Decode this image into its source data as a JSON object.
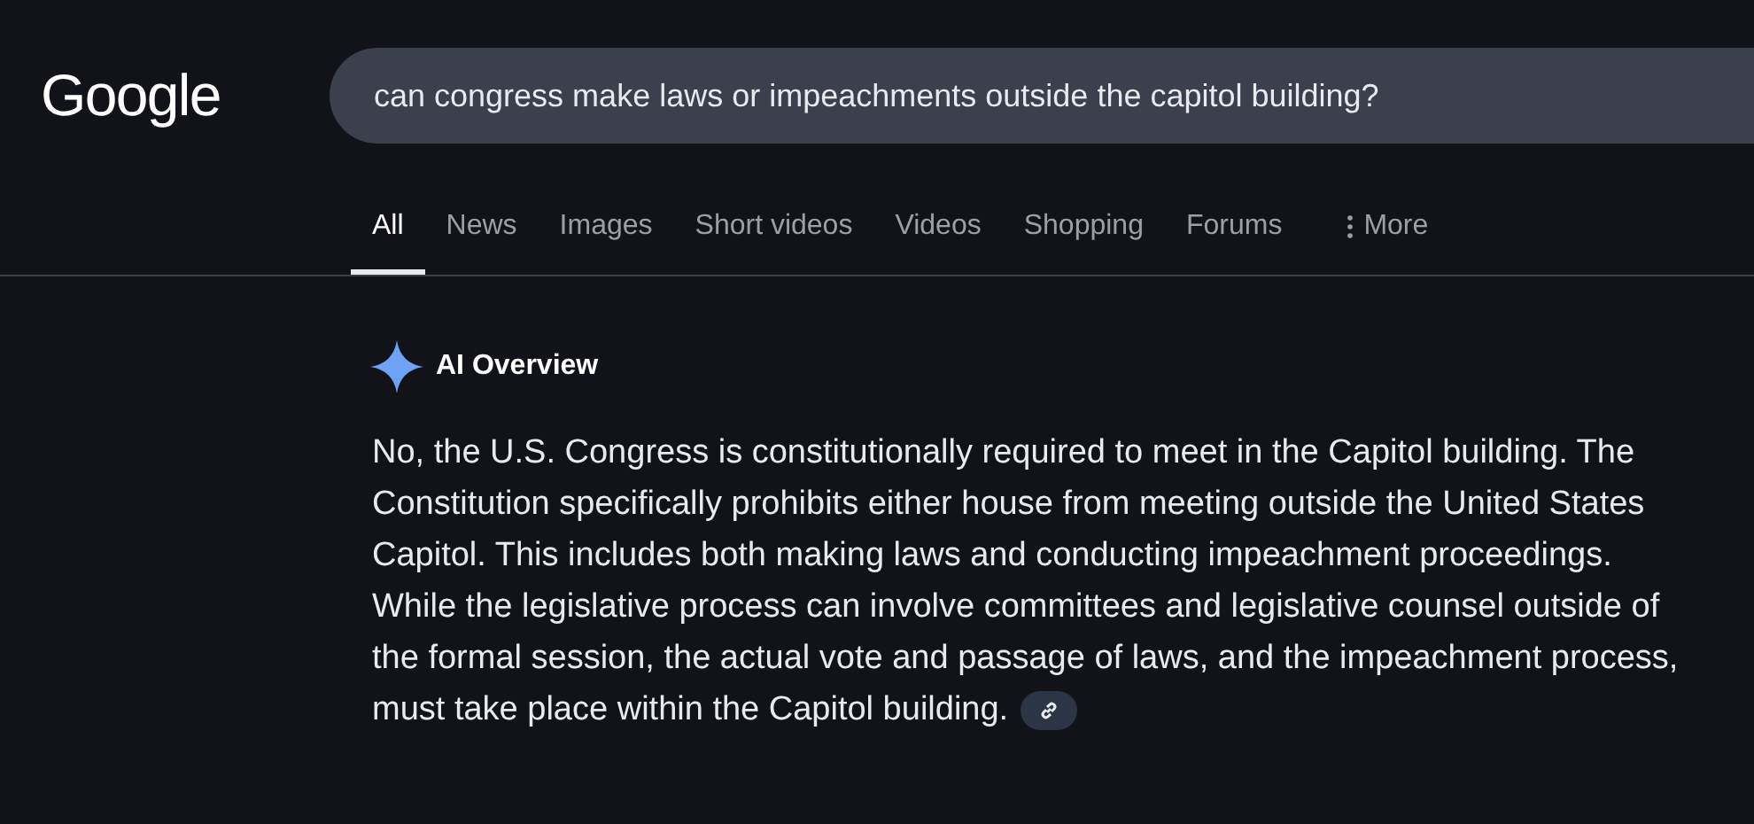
{
  "logo": "Google",
  "search": {
    "value": "can congress make laws or impeachments outside the capitol building?"
  },
  "tabs": [
    {
      "label": "All",
      "selected": true,
      "kind": "plain"
    },
    {
      "label": "News",
      "selected": false,
      "kind": "plain"
    },
    {
      "label": "Images",
      "selected": false,
      "kind": "plain"
    },
    {
      "label": "Short videos",
      "selected": false,
      "kind": "plain"
    },
    {
      "label": "Videos",
      "selected": false,
      "kind": "plain"
    },
    {
      "label": "Shopping",
      "selected": false,
      "kind": "plain"
    },
    {
      "label": "Forums",
      "selected": false,
      "kind": "plain"
    },
    {
      "label": "More",
      "selected": false,
      "kind": "more"
    }
  ],
  "ai_overview": {
    "title": "AI Overview",
    "text": "No, the U.S. Congress is constitutionally required to meet in the Capitol building. The Constitution specifically prohibits either house from meeting outside the United States Capitol. This includes both making laws and conducting impeachment proceedings. While the legislative process can involve committees and legislative counsel outside of the formal session, the actual vote and passage of laws, and the impeachment process, must take place within the Capitol building."
  }
}
